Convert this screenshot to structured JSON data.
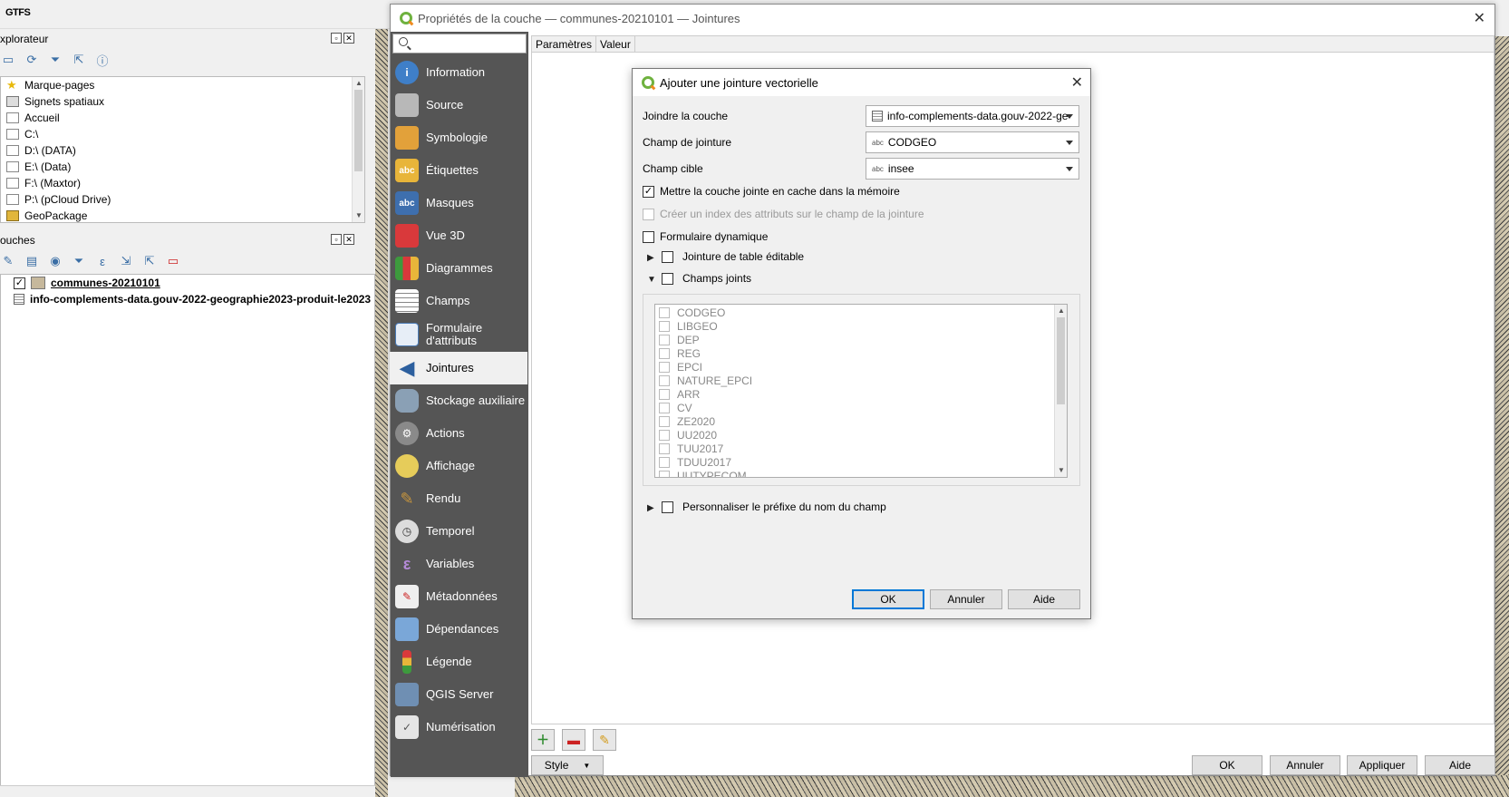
{
  "app": {
    "title_fragment": "GTFS"
  },
  "browser": {
    "title": "xplorateur",
    "items": [
      {
        "label": "Marque-pages",
        "icon": "star-icon"
      },
      {
        "label": "Signets spatiaux",
        "icon": "bookmark-icon"
      },
      {
        "label": "Accueil",
        "icon": "home-folder-icon"
      },
      {
        "label": "C:\\",
        "icon": "folder-icon"
      },
      {
        "label": "D:\\ (DATA)",
        "icon": "folder-icon"
      },
      {
        "label": "E:\\ (Data)",
        "icon": "folder-icon"
      },
      {
        "label": "F:\\ (Maxtor)",
        "icon": "folder-icon"
      },
      {
        "label": "P:\\ (pCloud Drive)",
        "icon": "folder-icon"
      },
      {
        "label": "GeoPackage",
        "icon": "geopackage-icon"
      }
    ]
  },
  "layers": {
    "title": "ouches",
    "items": [
      {
        "label": "communes-20210101",
        "checked": "✓"
      },
      {
        "label": "info-complements-data.gouv-2022-geographie2023-produit-le2023"
      }
    ]
  },
  "props": {
    "title": "Propriétés de la couche — communes-20210101 — Jointures",
    "nav": [
      {
        "label": "Information",
        "icon": "information-icon",
        "color": "#3f7fc8",
        "glyph": "i"
      },
      {
        "label": "Source",
        "icon": "source-icon",
        "color": "#b8b8b8",
        "glyph": ""
      },
      {
        "label": "Symbologie",
        "icon": "symbology-icon",
        "color": "#e2a13a",
        "glyph": ""
      },
      {
        "label": "Étiquettes",
        "icon": "labels-icon",
        "color": "#e8b53a",
        "glyph": "abc"
      },
      {
        "label": "Masques",
        "icon": "masks-icon",
        "color": "#3e6fae",
        "glyph": "abc"
      },
      {
        "label": "Vue 3D",
        "icon": "3d-view-icon",
        "color": "#d9393b",
        "glyph": ""
      },
      {
        "label": "Diagrammes",
        "icon": "diagrams-icon",
        "color": "#3d9a3d",
        "glyph": ""
      },
      {
        "label": "Champs",
        "icon": "fields-icon",
        "color": "#cfcfcf",
        "glyph": ""
      },
      {
        "label": "Formulaire d'attributs",
        "icon": "attribute-form-icon",
        "color": "#e7eef7",
        "glyph": ""
      },
      {
        "label": "Jointures",
        "icon": "joins-icon",
        "color": "#2c5f9e",
        "glyph": ""
      },
      {
        "label": "Stockage auxiliaire",
        "icon": "auxiliary-storage-icon",
        "color": "#8aa0b5",
        "glyph": ""
      },
      {
        "label": "Actions",
        "icon": "actions-icon",
        "color": "#8a8a8a",
        "glyph": ""
      },
      {
        "label": "Affichage",
        "icon": "display-icon",
        "color": "#e6cc5a",
        "glyph": ""
      },
      {
        "label": "Rendu",
        "icon": "rendering-icon",
        "color": "#c7953d",
        "glyph": ""
      },
      {
        "label": "Temporel",
        "icon": "temporal-icon",
        "color": "#dcdcdc",
        "glyph": ""
      },
      {
        "label": "Variables",
        "icon": "variables-icon",
        "color": "#7a5a9a",
        "glyph": "ε"
      },
      {
        "label": "Métadonnées",
        "icon": "metadata-icon",
        "color": "#efefef",
        "glyph": ""
      },
      {
        "label": "Dépendances",
        "icon": "dependencies-icon",
        "color": "#7aa7d8",
        "glyph": ""
      },
      {
        "label": "Légende",
        "icon": "legend-icon",
        "color": "#d8c24a",
        "glyph": ""
      },
      {
        "label": "QGIS Server",
        "icon": "qgis-server-icon",
        "color": "#6f8fb3",
        "glyph": ""
      },
      {
        "label": "Numérisation",
        "icon": "digitizing-icon",
        "color": "#e5e5e5",
        "glyph": ""
      }
    ],
    "columns": {
      "params": "Paramètres",
      "value": "Valeur"
    },
    "style_label": "Style",
    "buttons": {
      "ok": "OK",
      "cancel": "Annuler",
      "apply": "Appliquer",
      "help": "Aide"
    }
  },
  "dialog": {
    "title": "Ajouter une jointure vectorielle",
    "join_layer_label": "Joindre la couche",
    "join_layer_value": "info-complements-data.gouv-2022-geog",
    "join_field_label": "Champ de jointure",
    "join_field_value": "CODGEO",
    "target_field_label": "Champ cible",
    "target_field_value": "insee",
    "field_type": "abc",
    "cache_label": "Mettre la couche jointe en cache dans la mémoire",
    "cache_checked": "✓",
    "index_label": "Créer un index des attributs sur le champ de la jointure",
    "dynamic_form_label": "Formulaire dynamique",
    "editable_label": "Jointure de table éditable",
    "joined_fields_label": "Champs joints",
    "fields": [
      "CODGEO",
      "LIBGEO",
      "DEP",
      "REG",
      "EPCI",
      "NATURE_EPCI",
      "ARR",
      "CV",
      "ZE2020",
      "UU2020",
      "TUU2017",
      "TDUU2017",
      "UUTYPECOM"
    ],
    "prefix_label": "Personnaliser le préfixe du nom du champ",
    "buttons": {
      "ok": "OK",
      "cancel": "Annuler",
      "help": "Aide"
    }
  }
}
